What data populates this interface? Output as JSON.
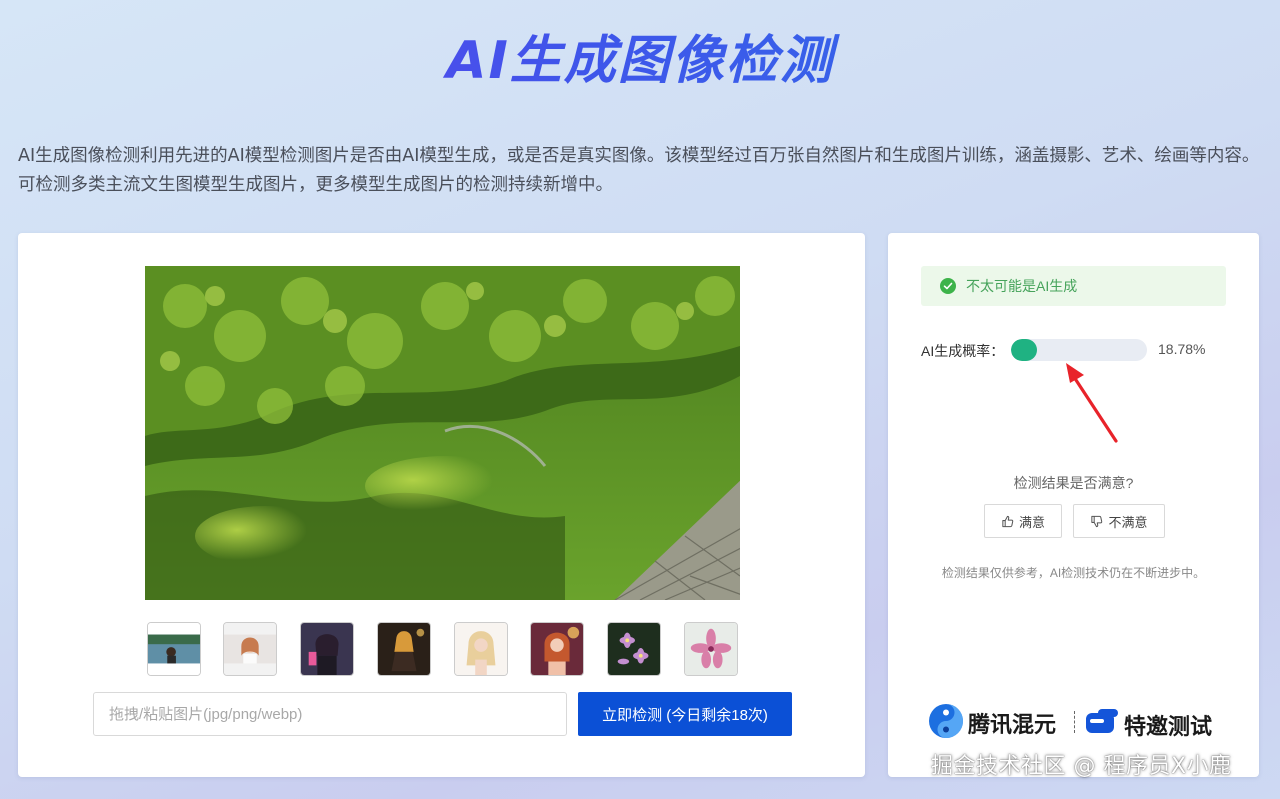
{
  "header": {
    "title": "AI生成图像检测",
    "description": "AI生成图像检测利用先进的AI模型检测图片是否由AI模型生成，或是否是真实图像。该模型经过百万张自然图片和生成图片训练，涵盖摄影、艺术、绘画等内容。可检测多类主流文生图模型生成图片，更多模型生成图片的检测持续新增中。"
  },
  "upload": {
    "placeholder": "拖拽/粘贴图片(jpg/png/webp)",
    "detect_button": "立即检测 (今日剩余18次)"
  },
  "samples": [
    {
      "icon": "lake-woman-thumbnail"
    },
    {
      "icon": "girl-portrait-thumbnail"
    },
    {
      "icon": "anime-girl-thumbnail"
    },
    {
      "icon": "fantasy-girl-thumbnail"
    },
    {
      "icon": "blonde-woman-thumbnail"
    },
    {
      "icon": "redhead-woman-thumbnail"
    },
    {
      "icon": "pink-flowers-thumbnail"
    },
    {
      "icon": "pink-lily-thumbnail"
    }
  ],
  "result": {
    "status_text": "不太可能是AI生成",
    "status_color": "#46a35b",
    "probability_label": "AI生成概率：",
    "probability_value": "18.78%",
    "probability_fraction": 0.1878,
    "bar_color": "#1fb282"
  },
  "feedback": {
    "question": "检测结果是否满意?",
    "satisfied_label": "满意",
    "unsatisfied_label": "不满意",
    "disclaimer": "检测结果仅供参考，AI检测技术仍在不断进步中。"
  },
  "brand": {
    "name": "腾讯混元",
    "invite": "特邀测试"
  },
  "watermark": "掘金技术社区 @ 程序员X小鹿",
  "colors": {
    "primary_button": "#0b50d6",
    "annotation_arrow": "#e8232a"
  }
}
